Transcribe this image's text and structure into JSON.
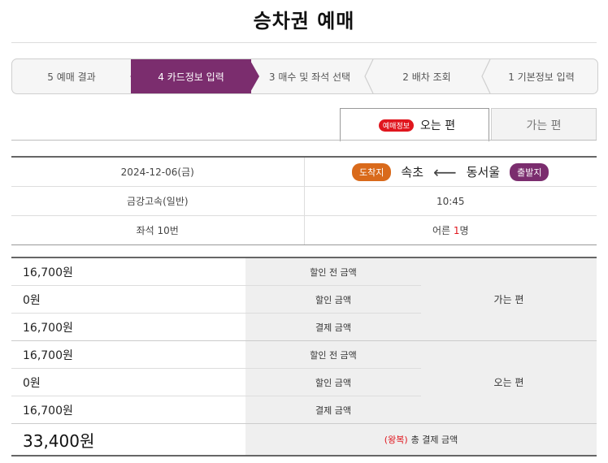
{
  "page": {
    "title": "승차권 예매"
  },
  "steps": [
    {
      "label": "5 예매 결과"
    },
    {
      "label": "4 카드정보 입력"
    },
    {
      "label": "3 매수 및 좌석 선택"
    },
    {
      "label": "2 배차 조회"
    },
    {
      "label": "1 기본정보 입력"
    }
  ],
  "tabs": {
    "return_label": "오는 편",
    "return_badge": "예매정보",
    "outbound_label": "가는 편"
  },
  "trip": {
    "destination_badge": "도착지",
    "destination": "속초",
    "arrow": "⟵",
    "origin": "동서울",
    "origin_badge": "출발지",
    "date": "2024-12-06(금)",
    "departure_time": "10:45",
    "company": "금강고속(일반)",
    "seat": "좌석 10번",
    "passenger_label": "어른",
    "passenger_count": "1",
    "passenger_unit": "명"
  },
  "fare": {
    "outbound": {
      "group_label": "가는 편",
      "rows": [
        {
          "label": "할인 전 금액",
          "amount": "16,700원"
        },
        {
          "label": "할인 금액",
          "amount": "0원"
        },
        {
          "label": "결제 금액",
          "amount": "16,700원"
        }
      ]
    },
    "return": {
      "group_label": "오는 편",
      "rows": [
        {
          "label": "할인 전 금액",
          "amount": "16,700원"
        },
        {
          "label": "할인 금액",
          "amount": "0원"
        },
        {
          "label": "결제 금액",
          "amount": "16,700원"
        }
      ]
    },
    "total_label": "총 결제 금액",
    "total_note": "(왕복)",
    "total_amount": "33,400원"
  },
  "colors": {
    "accent": "#7b2d6e",
    "destination": "#d96a1b",
    "alert": "#e0161e"
  }
}
